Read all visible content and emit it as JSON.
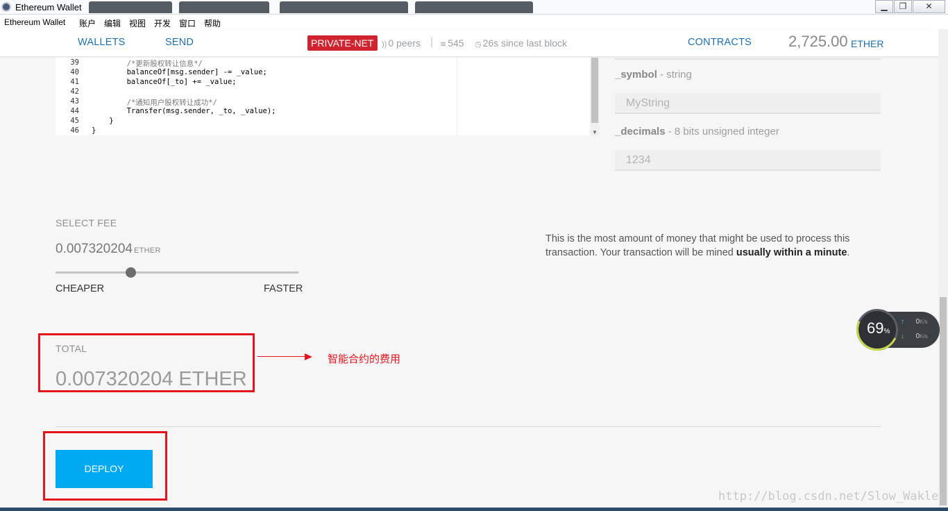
{
  "window": {
    "title": "Ethereum Wallet"
  },
  "menu": [
    "Ethereum Wallet",
    "账户",
    "编辑",
    "视图",
    "开发",
    "窗口",
    "帮助"
  ],
  "nav": {
    "wallets": "WALLETS",
    "send": "SEND",
    "network": "PRIVATE-NET",
    "peers": "0 peers",
    "separator": "|",
    "blocks": "545",
    "last_block": "26s since last block",
    "contracts": "CONTRACTS",
    "balance": "2,725.00",
    "balance_unit": "ETHER"
  },
  "code": {
    "lines": [
      {
        "num": "39",
        "text": "        /*更新股权转让信息*/",
        "comment": true
      },
      {
        "num": "40",
        "text": "        balanceOf[msg.sender] -= _value;",
        "comment": false
      },
      {
        "num": "41",
        "text": "        balanceOf[_to] += _value;",
        "comment": false
      },
      {
        "num": "42",
        "text": "",
        "comment": false
      },
      {
        "num": "43",
        "text": "        /*通知用户股权转让成功*/",
        "comment": true
      },
      {
        "num": "44",
        "text": "        Transfer(msg.sender, _to, _value);",
        "comment": false
      },
      {
        "num": "45",
        "text": "    }",
        "comment": false
      },
      {
        "num": "46",
        "text": "}",
        "comment": false
      }
    ]
  },
  "form": {
    "symbol_label": "_symbol",
    "symbol_type": " - string",
    "symbol_value": "MyString",
    "decimals_label": "_decimals",
    "decimals_type": " - 8 bits unsigned integer",
    "decimals_value": "1234"
  },
  "fee": {
    "label": "SELECT FEE",
    "value": "0.007320204",
    "unit": "ETHER",
    "slider_position": 0.31,
    "cheaper": "CHEAPER",
    "faster": "FASTER",
    "note_prefix": "This is the most amount of money that might be used to process this transaction. Your transaction will be mined ",
    "note_bold": "usually within a minute",
    "note_suffix": "."
  },
  "total": {
    "label": "TOTAL",
    "value": "0.007320204 ETHER"
  },
  "annotation": {
    "text": "智能合约的费用"
  },
  "deploy": {
    "label": "DEPLOY"
  },
  "speed_widget": {
    "percent": "69",
    "percent_sign": "%",
    "up_rate": "0",
    "down_rate": "0",
    "rate_unit": "K/s"
  },
  "watermark": "http://blog.csdn.net/Slow_Wakler",
  "colors": {
    "accent": "#1d6fae",
    "network_badge": "#d0232f",
    "deploy": "#00aaf0",
    "annotation": "#e5131d"
  }
}
